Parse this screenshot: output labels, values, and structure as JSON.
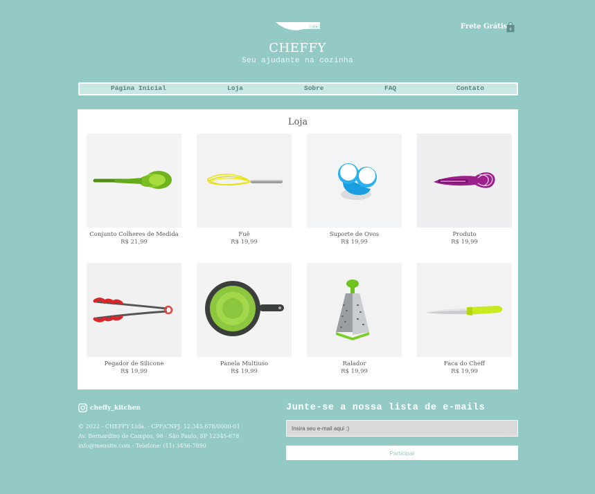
{
  "header": {
    "brand": "CHEFFY",
    "tagline": "Seu ajudante na cozinha",
    "shipping": "Frete Grátis",
    "separator": "|",
    "cart_count": "0"
  },
  "nav": {
    "items": [
      {
        "label": "Página Inicial"
      },
      {
        "label": "Loja"
      },
      {
        "label": "Sobre"
      },
      {
        "label": "FAQ"
      },
      {
        "label": "Contato"
      }
    ]
  },
  "shop": {
    "title": "Loja",
    "products": [
      {
        "name": "Conjunto Colheres de Medida",
        "price": "R$ 21,99",
        "icon": "measuring-spoons-image"
      },
      {
        "name": "Fuê",
        "price": "R$ 19,99",
        "icon": "whisk-image"
      },
      {
        "name": "Suporte de Ovos",
        "price": "R$ 19,99",
        "icon": "egg-holder-image"
      },
      {
        "name": "Produto",
        "price": "R$ 19,99",
        "icon": "purple-whisk-image"
      },
      {
        "name": "Pegador de Silicone",
        "price": "R$ 19,99",
        "icon": "tongs-image"
      },
      {
        "name": "Panela Multiuso",
        "price": "R$ 19,99",
        "icon": "pan-image"
      },
      {
        "name": "Ralador",
        "price": "R$ 19,99",
        "icon": "grater-image"
      },
      {
        "name": "Faca do Cheff",
        "price": "R$ 19,99",
        "icon": "knife-image"
      }
    ]
  },
  "footer": {
    "instagram_handle": "cheffy_kitchen",
    "lines": [
      "© 2022 - CHEFFY Ltda. - CPF/CNPJ: 12.345.678/0000-01",
      "Av. Bernardino de Campos, 98 - São Paulo, SP 12345-678",
      "info@meusite.com - Telefone: (11) 3456-7890"
    ],
    "newsletter_title": "Junte-se a nossa lista de e-mails",
    "email_placeholder": "Insira seu e-mail aqui :)",
    "subscribe_label": "Participar"
  },
  "colors": {
    "background": "#93cac6",
    "nav_bg": "#c9e7e4",
    "accent": "#93cac6"
  }
}
